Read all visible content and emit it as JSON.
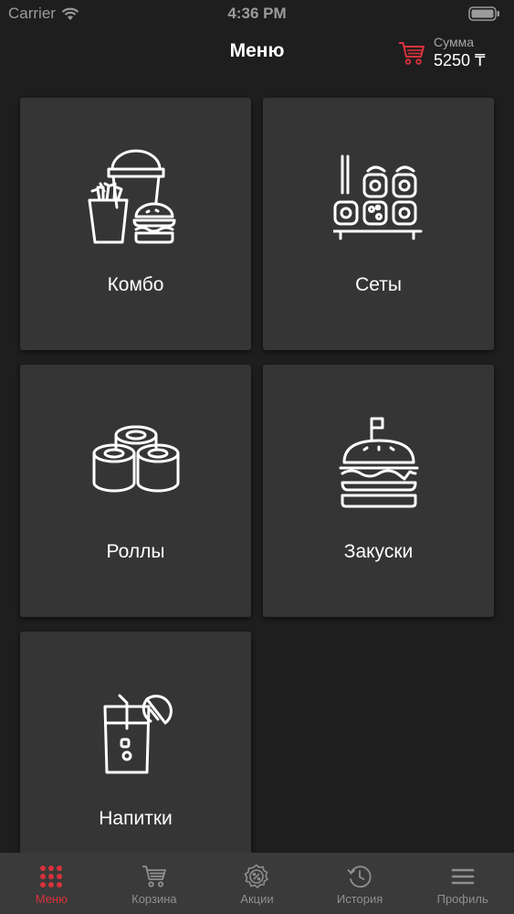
{
  "status_bar": {
    "carrier": "Carrier",
    "time": "4:36 PM"
  },
  "header": {
    "title": "Меню",
    "sum_label": "Сумма",
    "sum_value": "5250 ₸"
  },
  "categories": [
    {
      "label": "Комбо",
      "icon": "combo-icon"
    },
    {
      "label": "Сеты",
      "icon": "sushi-set-icon"
    },
    {
      "label": "Роллы",
      "icon": "rolls-icon"
    },
    {
      "label": "Закуски",
      "icon": "burger-icon"
    },
    {
      "label": "Напитки",
      "icon": "drink-icon"
    }
  ],
  "tab_bar": {
    "items": [
      {
        "label": "Меню",
        "icon": "grid-dots-icon",
        "active": true
      },
      {
        "label": "Корзина",
        "icon": "cart-icon",
        "active": false
      },
      {
        "label": "Акции",
        "icon": "discount-badge-icon",
        "active": false
      },
      {
        "label": "История",
        "icon": "history-icon",
        "active": false
      },
      {
        "label": "Профиль",
        "icon": "hamburger-menu-icon",
        "active": false
      }
    ]
  },
  "colors": {
    "background": "#1e1e1f",
    "tile": "#353536",
    "tab_bar": "#3a3a3b",
    "accent": "#d8323b",
    "inactive": "#8f8f8f"
  }
}
